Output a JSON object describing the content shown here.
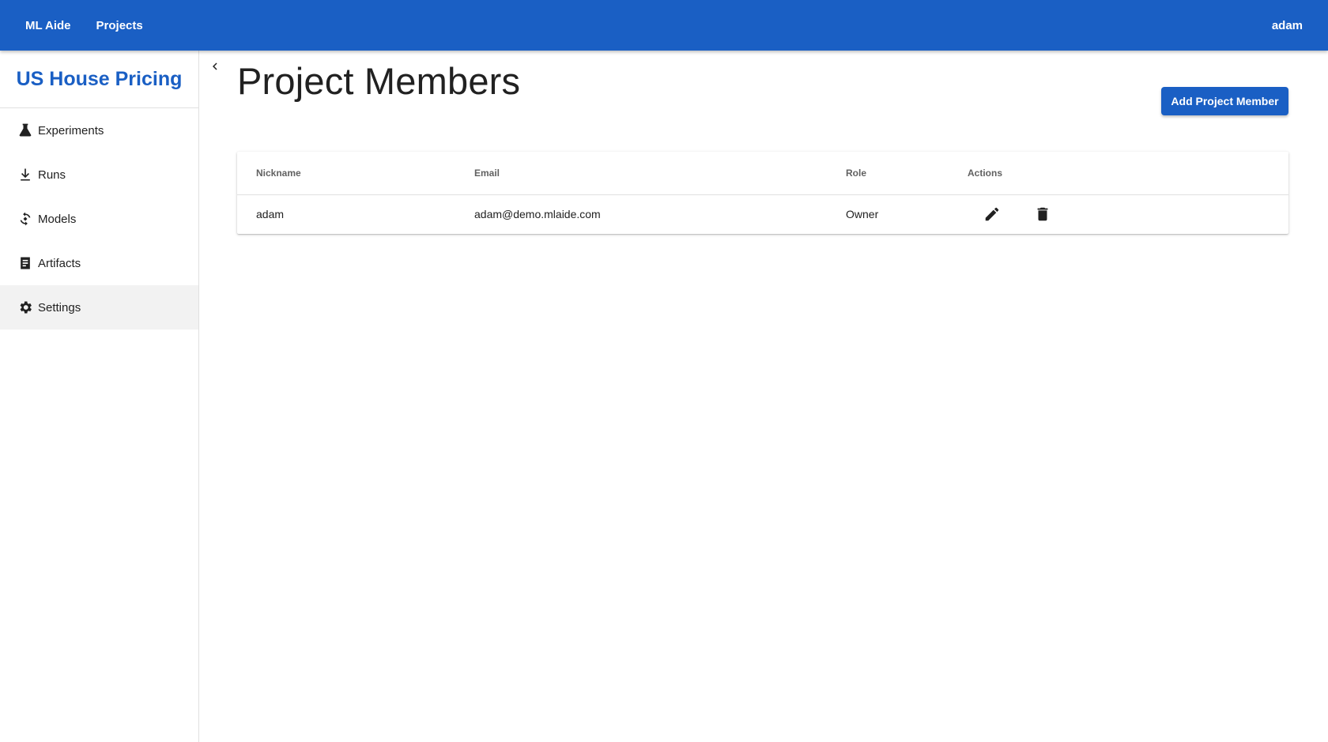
{
  "topbar": {
    "brand": "ML Aide",
    "projects_link": "Projects",
    "user": "adam"
  },
  "sidebar": {
    "project_title": "US House Pricing",
    "items": [
      {
        "label": "Experiments",
        "icon": "flask-icon"
      },
      {
        "label": "Runs",
        "icon": "run-download-icon"
      },
      {
        "label": "Models",
        "icon": "model-cycle-icon"
      },
      {
        "label": "Artifacts",
        "icon": "document-icon"
      },
      {
        "label": "Settings",
        "icon": "gear-icon",
        "active": true
      }
    ]
  },
  "main": {
    "title": "Project Members",
    "add_button": "Add Project Member",
    "table": {
      "headers": [
        "Nickname",
        "Email",
        "Role",
        "Actions"
      ],
      "rows": [
        {
          "nickname": "adam",
          "email": "adam@demo.mlaide.com",
          "role": "Owner"
        }
      ]
    }
  },
  "colors": {
    "primary": "#1a5fc4",
    "text": "#212121",
    "header_text": "#616161",
    "active_bg": "#f2f2f2"
  }
}
